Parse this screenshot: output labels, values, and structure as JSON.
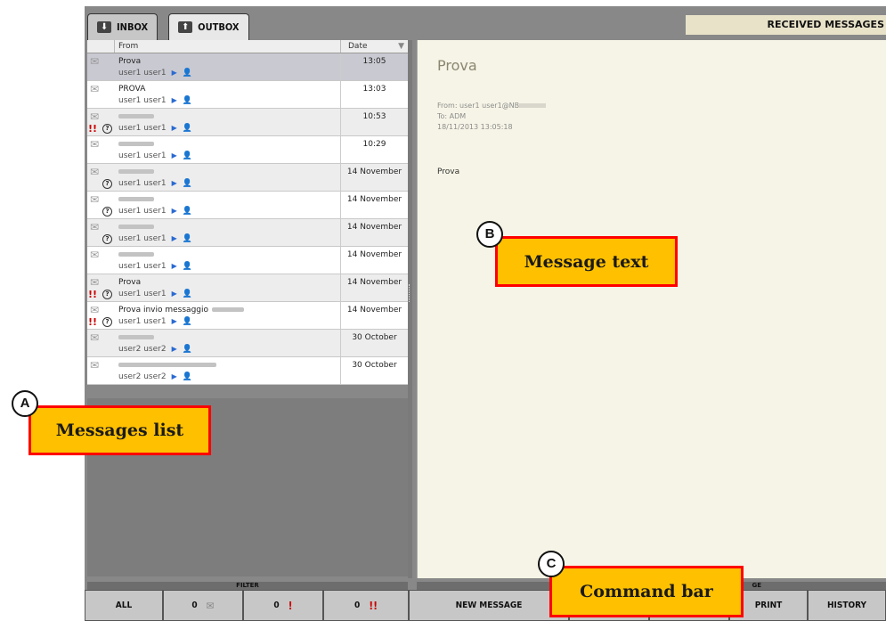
{
  "tabs": [
    {
      "label": "INBOX",
      "icon": "inbox-icon",
      "active": true
    },
    {
      "label": "OUTBOX",
      "icon": "outbox-icon",
      "active": false
    }
  ],
  "received_header": "RECEIVED MESSAGES",
  "list": {
    "columns": {
      "from": "From",
      "date": "Date"
    },
    "rows": [
      {
        "subject": "Prova",
        "from": "user1 user1",
        "date": "13:05",
        "urgent": false,
        "help": false,
        "blurred": false
      },
      {
        "subject": "PROVA",
        "from": "user1 user1",
        "date": "13:03",
        "urgent": false,
        "help": false,
        "blurred": false
      },
      {
        "subject": "",
        "from": "user1 user1",
        "date": "10:53",
        "urgent": true,
        "help": true,
        "blurred": true
      },
      {
        "subject": "",
        "from": "user1 user1",
        "date": "10:29",
        "urgent": false,
        "help": false,
        "blurred": true
      },
      {
        "subject": "",
        "from": "user1 user1",
        "date": "14 November",
        "urgent": false,
        "help": true,
        "blurred": true
      },
      {
        "subject": "",
        "from": "user1 user1",
        "date": "14 November",
        "urgent": false,
        "help": true,
        "blurred": true
      },
      {
        "subject": "",
        "from": "user1 user1",
        "date": "14 November",
        "urgent": false,
        "help": true,
        "blurred": true
      },
      {
        "subject": "",
        "from": "user1 user1",
        "date": "14 November",
        "urgent": false,
        "help": false,
        "blurred": true
      },
      {
        "subject": "Prova",
        "from": "user1 user1",
        "date": "14 November",
        "urgent": true,
        "help": true,
        "blurred": false
      },
      {
        "subject": "Prova invio messaggio",
        "from": "user1 user1",
        "date": "14 November",
        "urgent": true,
        "help": true,
        "blurred": false
      },
      {
        "subject": "",
        "from": "user2 user2",
        "date": "30 October",
        "urgent": false,
        "help": false,
        "blurred": true
      },
      {
        "subject": "",
        "from": "user2 user2",
        "date": "30 October",
        "urgent": false,
        "help": false,
        "blurred": true
      }
    ]
  },
  "message": {
    "subject": "Prova",
    "from_line": "From: user1 user1@NB",
    "to_line": "To: ADM",
    "datetime": "18/11/2013 13:05:18",
    "body": "Prova"
  },
  "bottom": {
    "filter_label": "FILTER",
    "command_label": "GE",
    "buttons": {
      "all": "ALL",
      "unread_count": "0",
      "urgent_count": "0",
      "very_urgent_count": "0",
      "new_message": "NEW MESSAGE",
      "print": "PRINT",
      "history": "HISTORY"
    }
  },
  "callouts": {
    "a": {
      "letter": "A",
      "label": "Messages list"
    },
    "b": {
      "letter": "B",
      "label": "Message text"
    },
    "c": {
      "letter": "C",
      "label": "Command bar"
    }
  },
  "colors": {
    "callout_fill": "#ffc000",
    "callout_border": "#ff0000",
    "panel_background": "#f6f4e6",
    "button_background": "#c7c7c7"
  }
}
